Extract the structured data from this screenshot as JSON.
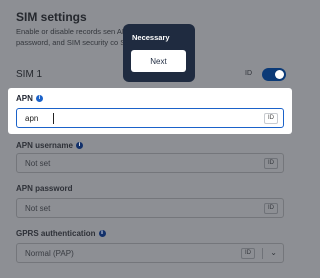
{
  "section": {
    "title": "SIM settings",
    "description_lines": [
      "Enable or disable records sen                          APN, APN user, APN",
      "password, and SIM security co                          SIM card."
    ]
  },
  "sim": {
    "label": "SIM 1",
    "id_badge": "ID",
    "enabled": true
  },
  "fields": {
    "apn": {
      "label": "APN",
      "value": "apn",
      "id_chip": "ID"
    },
    "apn_username": {
      "label": "APN username",
      "placeholder": "Not set",
      "id_chip": "ID"
    },
    "apn_password": {
      "label": "APN password",
      "placeholder": "Not set",
      "id_chip": "ID"
    },
    "gprs_auth": {
      "label": "GPRS authentication",
      "value": "Normal (PAP)",
      "id_chip": "ID"
    }
  },
  "tooltip": {
    "title": "Necessary",
    "next_label": "Next"
  },
  "icons": {
    "info": "info-icon",
    "chevron": "chevron-down-icon"
  },
  "colors": {
    "overlay": "#8d8f94",
    "accent": "#1b62c9",
    "toggle": "#0b3a77",
    "tooltip_bg": "#1f2b40"
  }
}
